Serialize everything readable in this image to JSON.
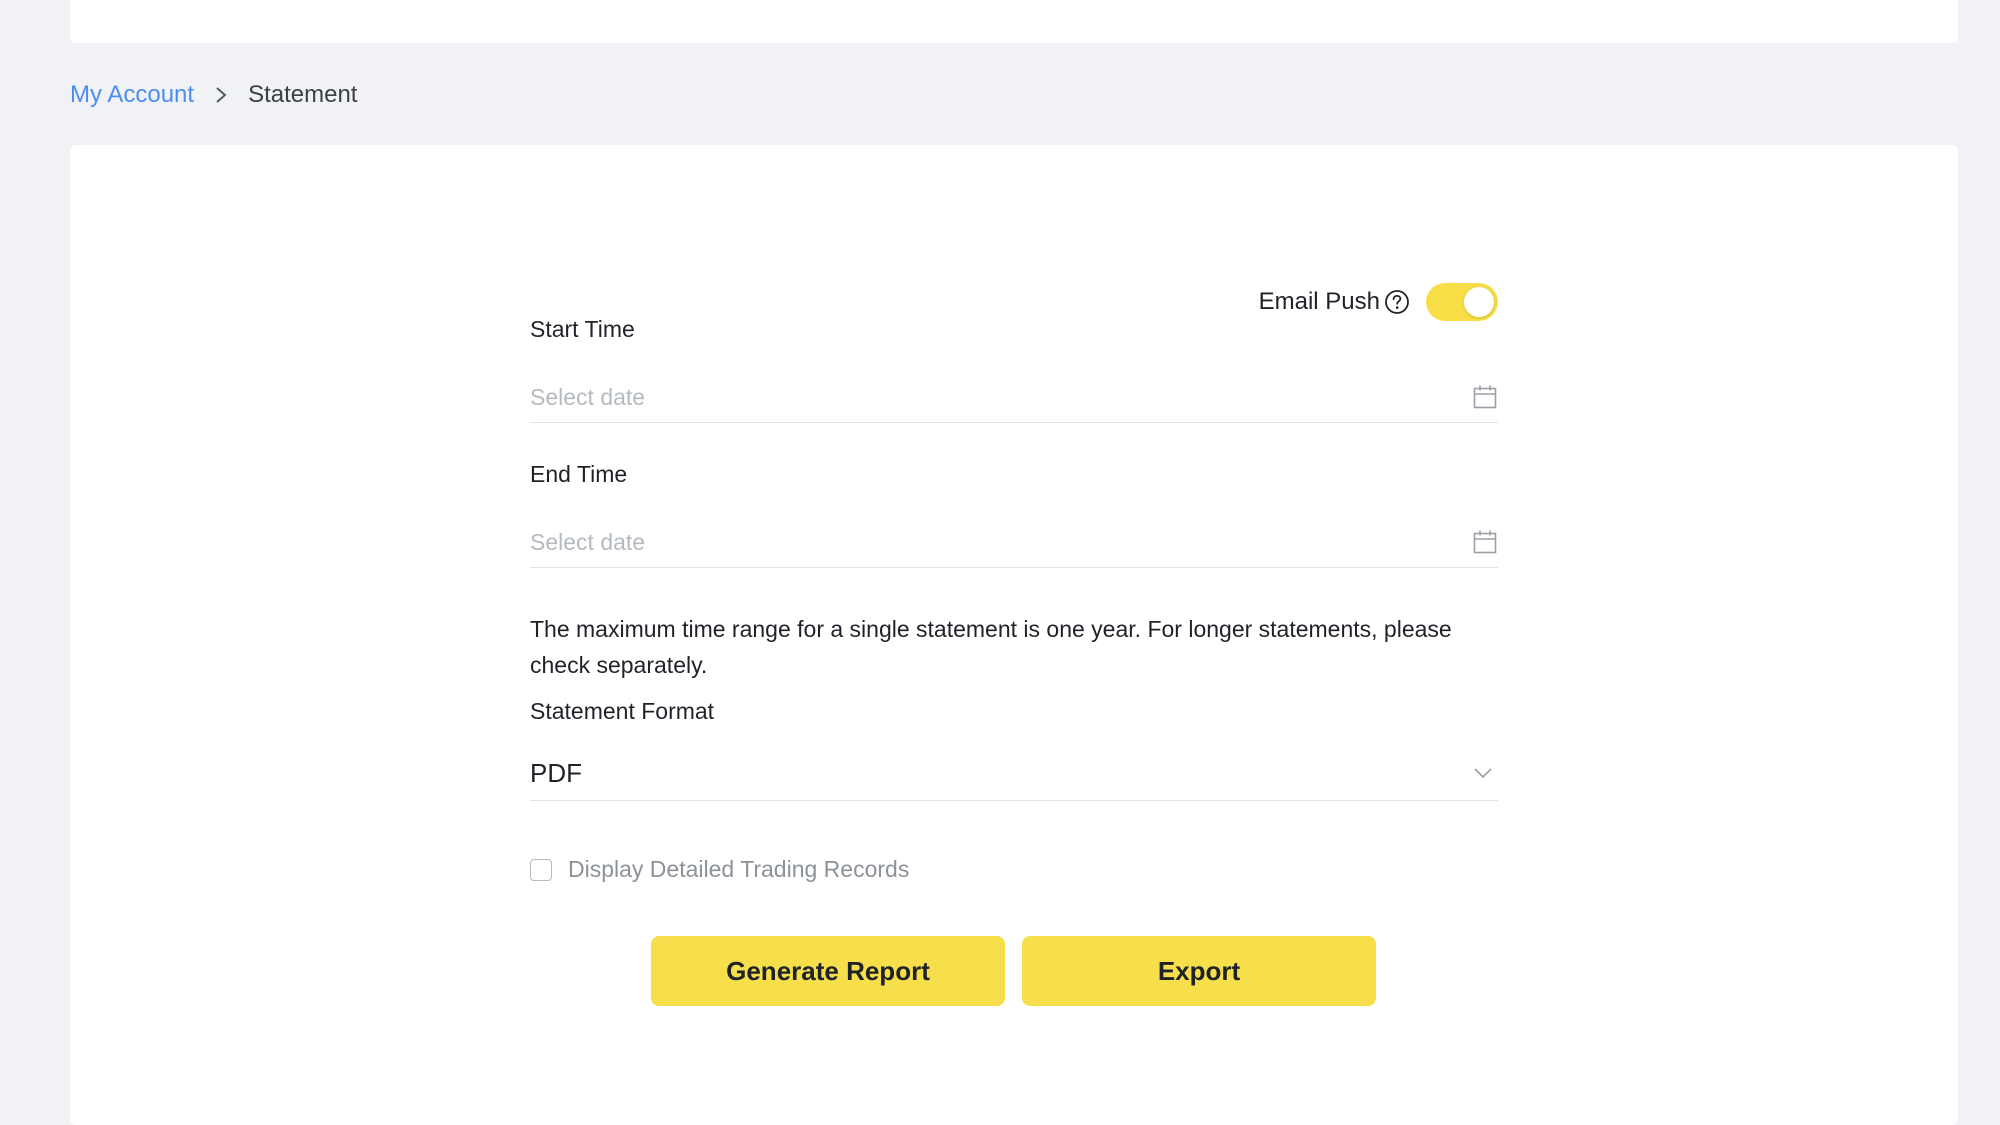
{
  "breadcrumb": {
    "parent": "My Account",
    "current": "Statement"
  },
  "email_push": {
    "label": "Email Push",
    "enabled": true
  },
  "start_time": {
    "label": "Start Time",
    "placeholder": "Select date"
  },
  "end_time": {
    "label": "End Time",
    "placeholder": "Select date"
  },
  "notice": "The maximum time range for a single statement is one year. For longer statements, please check separately.",
  "statement_format": {
    "label": "Statement Format",
    "value": "PDF"
  },
  "detailed_records": {
    "label": "Display Detailed Trading Records",
    "checked": false
  },
  "buttons": {
    "generate": "Generate Report",
    "export": "Export"
  },
  "colors": {
    "accent": "#f7df4b",
    "link": "#4a8ef0",
    "background": "#f1f2f6"
  },
  "icons": {
    "breadcrumb_separator": "chevron-right-icon",
    "email_help": "help-circle-icon",
    "date_picker": "calendar-icon",
    "select": "chevron-down-icon"
  }
}
